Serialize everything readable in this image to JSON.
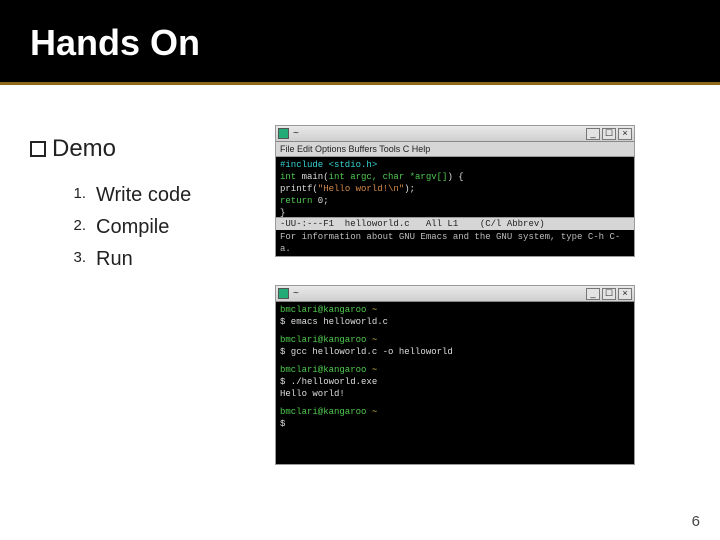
{
  "title": "Hands On",
  "demo_label": "Demo",
  "steps": [
    {
      "n": "1.",
      "t": "Write code"
    },
    {
      "n": "2.",
      "t": "Compile"
    },
    {
      "n": "3.",
      "t": "Run"
    }
  ],
  "page_number": "6",
  "win_common": {
    "title": "~",
    "btn_min": "_",
    "btn_max": "☐",
    "btn_close": "×"
  },
  "win1": {
    "menubar": "File  Edit  Options  Buffers  Tools  C  Help",
    "line_include": "#include <stdio.h>",
    "sig_pre": "int",
    "sig_mid": " main(",
    "sig_args": "int argc, char *argv[]",
    "sig_post": ") {",
    "printf_call": "    printf(",
    "printf_str": "\"Hello world!\\n\"",
    "printf_end": ");",
    "return_kw": "    return",
    "return_val": " 0;",
    "brace": "}",
    "modeline": "-UU-:---F1  helloworld.c   All L1    (C/l Abbrev)",
    "echo": "For information about GNU Emacs and the GNU system, type C-h C-a."
  },
  "win2": {
    "prompt_user": "bmclari@kangaroo",
    "prompt_path": " ~",
    "cmd1": "$ emacs helloworld.c",
    "cmd2": "$ gcc helloworld.c -o helloworld",
    "cmd3_a": "$ ./helloworld.exe",
    "out3": "Hello world!",
    "cmd4": "$"
  }
}
